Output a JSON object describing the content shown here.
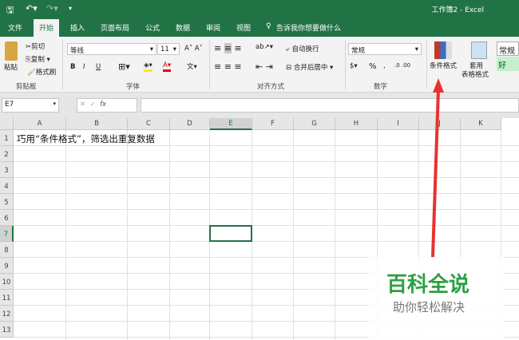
{
  "title": {
    "doc": "工作簿2  -  Excel"
  },
  "tabs": [
    "文件",
    "开始",
    "插入",
    "页面布局",
    "公式",
    "数据",
    "审阅",
    "视图"
  ],
  "tell_me": "告诉我你想要做什么",
  "ribbon": {
    "clipboard": {
      "paste": "粘贴",
      "cut": "剪切",
      "copy": "复制",
      "format_painter": "格式刷",
      "label": "剪贴板"
    },
    "font": {
      "name": "等线",
      "size": "11",
      "bold": "B",
      "italic": "I",
      "underline": "U",
      "label": "字体"
    },
    "align": {
      "wrap": "自动换行",
      "merge": "合并后居中",
      "label": "对齐方式"
    },
    "number": {
      "format": "常规",
      "percent": "%",
      "comma": ",",
      "label": "数字"
    },
    "styles": {
      "cond": "条件格式",
      "table1": "套用",
      "table2": "表格格式",
      "normal": "常规",
      "good": "好"
    }
  },
  "formula_bar": {
    "cell_ref": "E7",
    "fx": "fx",
    "value": ""
  },
  "columns": [
    "A",
    "B",
    "C",
    "D",
    "E",
    "F",
    "G",
    "H",
    "I",
    "J",
    "K"
  ],
  "rows": [
    "1",
    "2",
    "3",
    "4",
    "5",
    "6",
    "7",
    "8",
    "9",
    "10",
    "11",
    "12",
    "13"
  ],
  "cells": {
    "A1": "巧用“条件格式”，筛选出重复数据"
  },
  "watermark": {
    "title": "百科全说",
    "subtitle": "助你轻松解决"
  }
}
